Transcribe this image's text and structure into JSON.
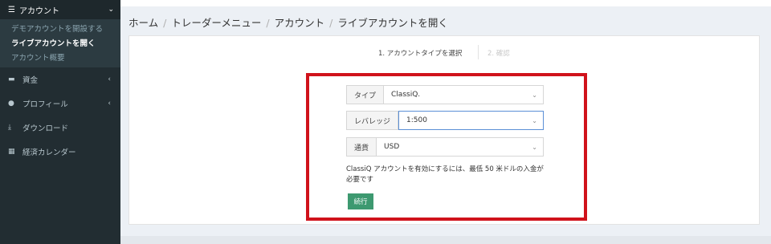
{
  "sidebar": {
    "header": {
      "icon": "list-icon",
      "label": "アカウント",
      "chevron": "chevron-down-icon"
    },
    "submenu": [
      {
        "label": "デモアカウントを開設する",
        "active": false
      },
      {
        "label": "ライブアカウントを開く",
        "active": true
      },
      {
        "label": "アカウント概要",
        "active": false
      }
    ],
    "items": [
      {
        "icon": "wallet-icon",
        "label": "資金",
        "has_arrow": true
      },
      {
        "icon": "user-icon",
        "label": "プロフィール",
        "has_arrow": true
      },
      {
        "icon": "download-icon",
        "label": "ダウンロード",
        "has_arrow": false
      },
      {
        "icon": "calendar-icon",
        "label": "経済カレンダー",
        "has_arrow": false
      }
    ]
  },
  "breadcrumb": [
    "ホーム",
    "トレーダーメニュー",
    "アカウント",
    "ライブアカウントを開く"
  ],
  "steps": {
    "step1": "1. アカウントタイプを選択",
    "step2": "2. 確認"
  },
  "form": {
    "type_label": "タイプ",
    "type_value": "ClassiQ.",
    "leverage_label": "レバレッジ",
    "leverage_value": "1:500",
    "currency_label": "通貨",
    "currency_value": "USD",
    "notice": "ClassiQ アカウントを有効にするには、最低 50 米ドルの入金が必要です",
    "continue_label": "続行"
  },
  "colors": {
    "sidebar_bg": "#222d32",
    "highlight_border": "#d0121b",
    "continue_button": "#3d9970"
  }
}
